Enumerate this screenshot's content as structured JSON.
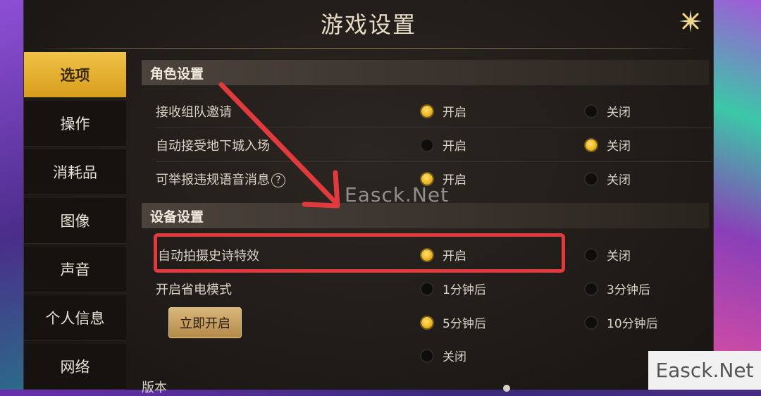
{
  "dialog": {
    "title": "游戏设置"
  },
  "nav": {
    "items": [
      {
        "label": "选项",
        "active": true
      },
      {
        "label": "操作"
      },
      {
        "label": "消耗品"
      },
      {
        "label": "图像"
      },
      {
        "label": "声音"
      },
      {
        "label": "个人信息"
      },
      {
        "label": "网络"
      }
    ]
  },
  "sections": {
    "role": {
      "title": "角色设置",
      "rows": [
        {
          "label": "接收组队邀请",
          "on": "开启",
          "off": "关闭",
          "selected": "on"
        },
        {
          "label": "自动接受地下城入场",
          "on": "开启",
          "off": "关闭",
          "selected": "off"
        },
        {
          "label": "可举报违规语音消息",
          "on": "开启",
          "off": "关闭",
          "selected": "on"
        }
      ]
    },
    "device": {
      "title": "设备设置",
      "epic_capture": {
        "label": "自动拍摄史诗特效",
        "on": "开启",
        "off": "关闭",
        "selected": "on"
      },
      "power_saving": {
        "label": "开启省电模式",
        "activate_button": "立即开启",
        "options": [
          "1分钟后",
          "3分钟后",
          "5分钟后",
          "10分钟后",
          "关闭"
        ],
        "selected": "5分钟后"
      }
    },
    "version": {
      "label": "版本"
    }
  },
  "icons": {
    "help": "question-circle-icon",
    "close": "close-sparkle-icon",
    "help_glyph": "?"
  },
  "watermark": {
    "center": "Easck.Net",
    "corner": "Easck.Net"
  },
  "colors": {
    "accent": "#f1b81e",
    "highlight": "#e23a3c"
  }
}
